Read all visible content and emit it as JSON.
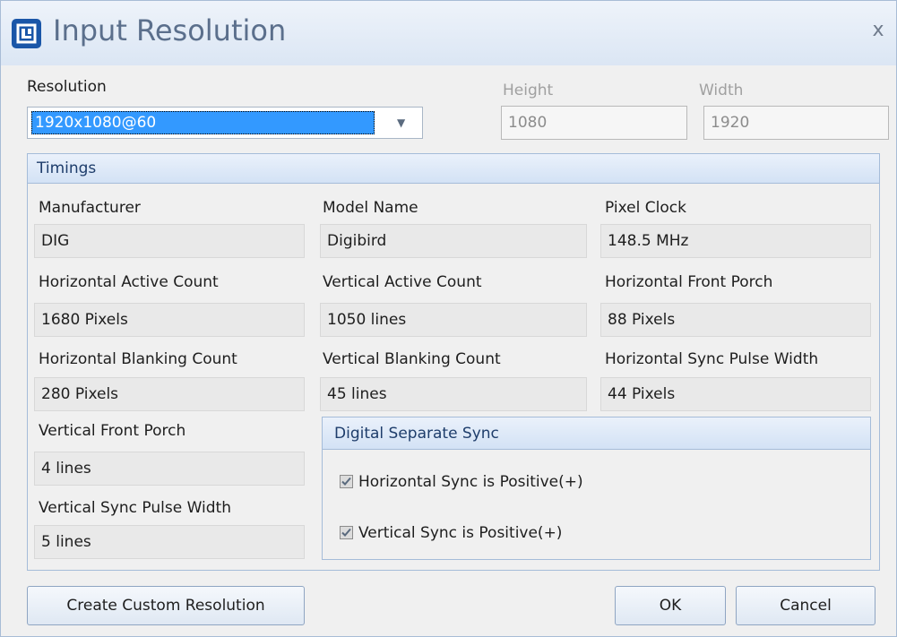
{
  "window": {
    "title": "Input Resolution",
    "close_glyph": "x",
    "icon": "app-logo-icon"
  },
  "resolution": {
    "label": "Resolution",
    "selected": "1920x1080@60",
    "height_label": "Height",
    "height_value": "1080",
    "width_label": "Width",
    "width_value": "1920"
  },
  "timings": {
    "title": "Timings",
    "fields": {
      "manufacturer": {
        "label": "Manufacturer",
        "value": "DIG"
      },
      "model_name": {
        "label": "Model Name",
        "value": "Digibird"
      },
      "pixel_clock": {
        "label": "Pixel Clock",
        "value": "148.5 MHz"
      },
      "h_active": {
        "label": "Horizontal Active Count",
        "value": "1680 Pixels"
      },
      "v_active": {
        "label": "Vertical Active Count",
        "value": "1050 lines"
      },
      "h_front_porch": {
        "label": "Horizontal Front Porch",
        "value": "88 Pixels"
      },
      "h_blanking": {
        "label": "Horizontal Blanking Count",
        "value": "280 Pixels"
      },
      "v_blanking": {
        "label": "Vertical Blanking Count",
        "value": "45 lines"
      },
      "h_sync_width": {
        "label": "Horizontal Sync Pulse Width",
        "value": "44 Pixels"
      },
      "v_front_porch": {
        "label": "Vertical Front Porch",
        "value": "4 lines"
      },
      "v_sync_width": {
        "label": "Vertical Sync Pulse Width",
        "value": "5 lines"
      }
    },
    "sync": {
      "title": "Digital Separate Sync",
      "h_positive": {
        "label": "Horizontal Sync is Positive(+)",
        "checked": true
      },
      "v_positive": {
        "label": "Vertical Sync is Positive(+)",
        "checked": true
      }
    }
  },
  "buttons": {
    "custom": "Create Custom Resolution",
    "ok": "OK",
    "cancel": "Cancel"
  },
  "colors": {
    "selection": "#3399ff",
    "header_text": "#1e3d6b",
    "border": "#a5bcd9"
  }
}
